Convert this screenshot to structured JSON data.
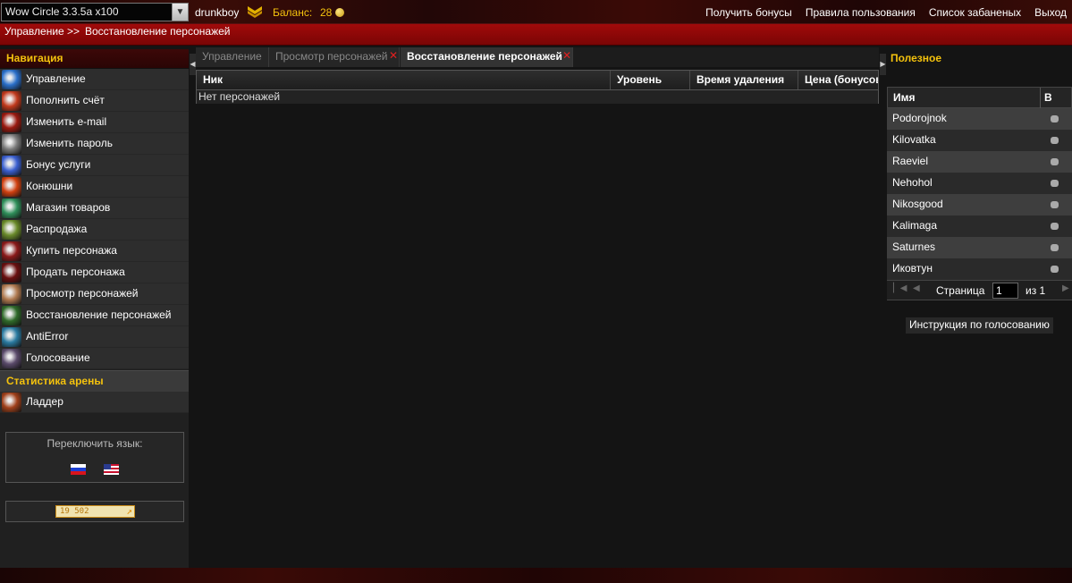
{
  "topbar": {
    "server_select": "Wow Circle 3.3.5a x100",
    "username": "drunkboy",
    "balance_label": "Баланс:",
    "balance_value": "28",
    "links": [
      "Получить бонусы",
      "Правила пользования",
      "Список забаненых",
      "Выход"
    ]
  },
  "breadcrumb": {
    "root": "Управление >>",
    "current": "Восстановление персонажей"
  },
  "sidebar": {
    "nav_header": "Навигация",
    "items": [
      {
        "label": "Управление",
        "icon": "management-icon",
        "color": "#2a6fc9"
      },
      {
        "label": "Пополнить счёт",
        "icon": "deposit-icon",
        "color": "#c0391c"
      },
      {
        "label": "Изменить e-mail",
        "icon": "email-icon",
        "color": "#9a1a10"
      },
      {
        "label": "Изменить пароль",
        "icon": "password-icon",
        "color": "#7a7a7a"
      },
      {
        "label": "Бонус услуги",
        "icon": "bonus-icon",
        "color": "#3a5fd0"
      },
      {
        "label": "Конюшни",
        "icon": "stables-icon",
        "color": "#d04010"
      },
      {
        "label": "Магазин товаров",
        "icon": "shop-icon",
        "color": "#2f8f5a"
      },
      {
        "label": "Распродажа",
        "icon": "sale-icon",
        "color": "#6a8a2a"
      },
      {
        "label": "Купить персонажа",
        "icon": "buy-character-icon",
        "color": "#8a1a1a"
      },
      {
        "label": "Продать персонажа",
        "icon": "sell-character-icon",
        "color": "#6a1010"
      },
      {
        "label": "Просмотр персонажей",
        "icon": "view-characters-icon",
        "color": "#b07a50"
      },
      {
        "label": "Восстановление персонажей",
        "icon": "restore-characters-icon",
        "color": "#2f6a2a"
      },
      {
        "label": "AntiError",
        "icon": "antierror-icon",
        "color": "#2a7aa0"
      },
      {
        "label": "Голосование",
        "icon": "voting-icon",
        "color": "#5a4a6a"
      }
    ],
    "arena_header": "Статистика арены",
    "arena_items": [
      {
        "label": "Ладдер",
        "icon": "ladder-icon",
        "color": "#a0401a"
      }
    ],
    "language_label": "Переключить язык:",
    "counter_value": "19 502"
  },
  "tabs": [
    {
      "label": "Управление",
      "closable": false
    },
    {
      "label": "Просмотр персонажей",
      "closable": true
    },
    {
      "label": "Восстановление персонажей",
      "closable": true,
      "active": true
    }
  ],
  "grid": {
    "columns": [
      "Ник",
      "Уровень",
      "Время удаления",
      "Цена (бонусов"
    ],
    "empty_text": "Нет персонажей"
  },
  "right_panel": {
    "title": "Полезное",
    "columns": [
      "Имя",
      "В игре"
    ],
    "rows": [
      "Podorojnok",
      "Kilovatka",
      "Raeviel",
      "Nehohol",
      "Nikosgood",
      "Kalimaga",
      "Saturnes",
      "Иковтун"
    ],
    "pager": {
      "page_label": "Страница",
      "page_value": "1",
      "of_label": "из 1"
    },
    "vote_button": "Инструкция по голосованию"
  },
  "colors": {
    "accent": "#f4c20d",
    "header_red": "#8a0707",
    "close_red": "#e02020"
  }
}
